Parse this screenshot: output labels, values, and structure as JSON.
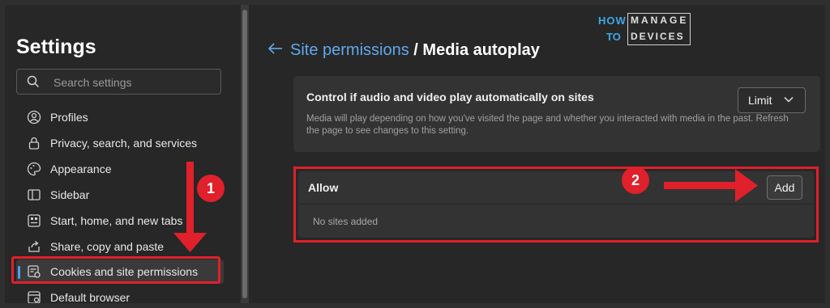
{
  "sidebar": {
    "title": "Settings",
    "search_placeholder": "Search settings",
    "items": [
      {
        "label": "Profiles",
        "icon": "profile-icon"
      },
      {
        "label": "Privacy, search, and services",
        "icon": "lock-icon"
      },
      {
        "label": "Appearance",
        "icon": "palette-icon"
      },
      {
        "label": "Sidebar",
        "icon": "sidebar-icon"
      },
      {
        "label": "Start, home, and new tabs",
        "icon": "home-tabs-icon"
      },
      {
        "label": "Share, copy and paste",
        "icon": "share-icon"
      },
      {
        "label": "Cookies and site permissions",
        "icon": "cookies-icon",
        "active": true
      },
      {
        "label": "Default browser",
        "icon": "browser-icon"
      }
    ]
  },
  "header": {
    "breadcrumb_link": "Site permissions",
    "separator": "/",
    "current": "Media autoplay"
  },
  "logo": {
    "how": "HOW",
    "to": "TO",
    "manage": "MANAGE",
    "devices": "DEVICES"
  },
  "autoplay": {
    "heading": "Control if audio and video play automatically on sites",
    "description": "Media will play depending on how you've visited the page and whether you interacted with media in the past. Refresh the page to see changes to this setting.",
    "dropdown_value": "Limit"
  },
  "allow": {
    "heading": "Allow",
    "add_label": "Add",
    "empty_text": "No sites added"
  },
  "annotations": {
    "badge1": "1",
    "badge2": "2"
  },
  "colors": {
    "accent": "#61a8ee",
    "highlight": "#e0202a",
    "background": "#272727"
  }
}
